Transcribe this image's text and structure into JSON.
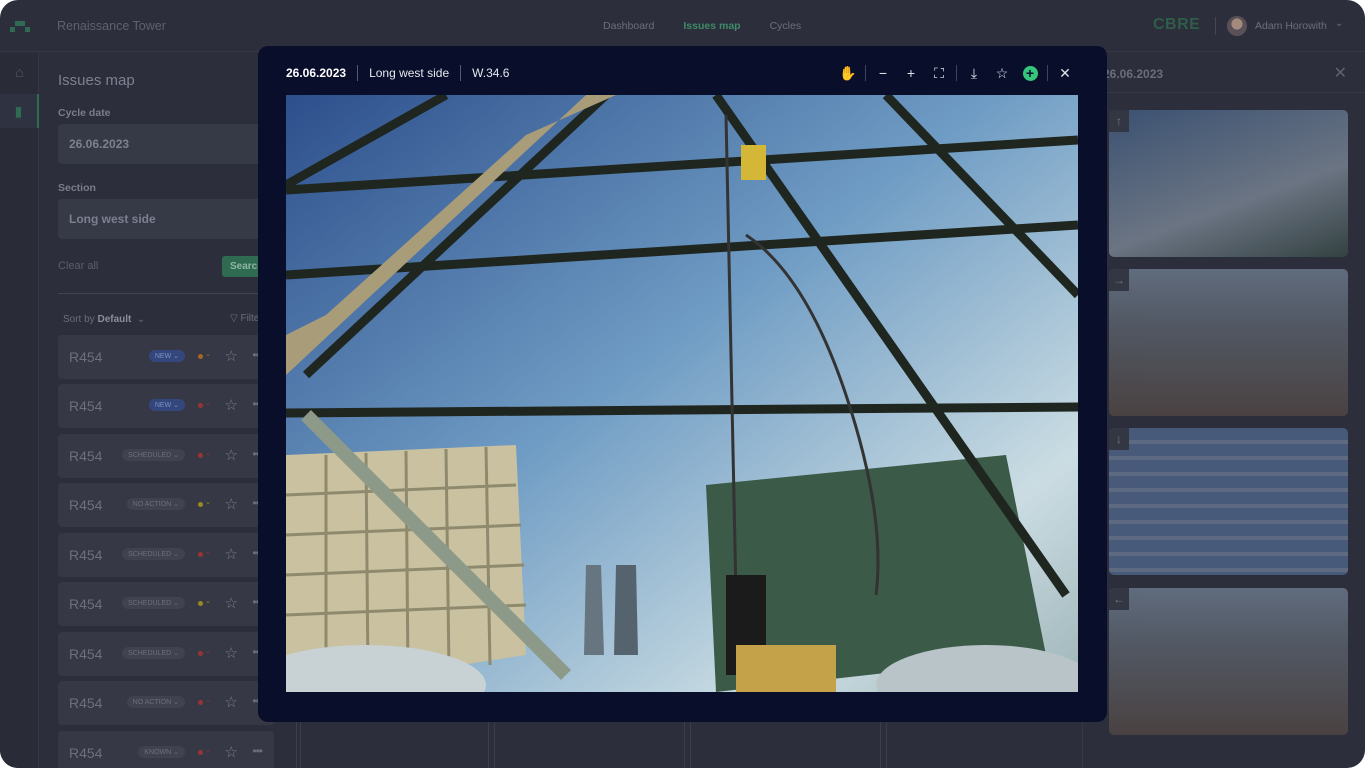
{
  "header": {
    "app_title": "Renaissance Tower",
    "nav": [
      "Dashboard",
      "Issues map",
      "Cycles"
    ],
    "active_nav": "Issues map",
    "brand": "CBRE",
    "user": "Adam Horowith"
  },
  "sidebar": {
    "title": "Issues map",
    "cycle_date_label": "Cycle date",
    "cycle_date": "26.06.2023",
    "section_label": "Section",
    "section": "Long west side",
    "clear_all": "Clear all",
    "search": "Search",
    "sort_prefix": "Sort by",
    "sort_value": "Default",
    "filter": "Filter",
    "issues": [
      {
        "code": "R454",
        "status": "NEW",
        "priority_color": "#a7661f"
      },
      {
        "code": "R454",
        "status": "NEW",
        "priority_color": "#9a3434"
      },
      {
        "code": "R454",
        "status": "SCHEDULED",
        "priority_color": "#9a3434"
      },
      {
        "code": "R454",
        "status": "NO ACTION",
        "priority_color": "#9a8a22"
      },
      {
        "code": "R454",
        "status": "SCHEDULED",
        "priority_color": "#9a3434"
      },
      {
        "code": "R454",
        "status": "SCHEDULED",
        "priority_color": "#9a8a22"
      },
      {
        "code": "R454",
        "status": "SCHEDULED",
        "priority_color": "#9a3434"
      },
      {
        "code": "R454",
        "status": "NO ACTION",
        "priority_color": "#9a3434"
      },
      {
        "code": "R454",
        "status": "KNOWN",
        "priority_color": "#9a3434"
      }
    ]
  },
  "right_panel": {
    "date": "26.06.2023",
    "thumbnails": [
      {
        "direction": "up"
      },
      {
        "direction": "right"
      },
      {
        "direction": "down"
      },
      {
        "direction": "left"
      }
    ]
  },
  "modal": {
    "date": "26.06.2023",
    "section": "Long west side",
    "location": "W.34.6",
    "tools": [
      "hand-icon",
      "zoom-out-icon",
      "zoom-in-icon",
      "fullscreen-icon",
      "download-icon",
      "star-icon",
      "add-icon",
      "close-icon"
    ]
  },
  "colors": {
    "accent": "#34c77b",
    "brand": "#2f6b50",
    "modal_bg": "#090e2b"
  }
}
